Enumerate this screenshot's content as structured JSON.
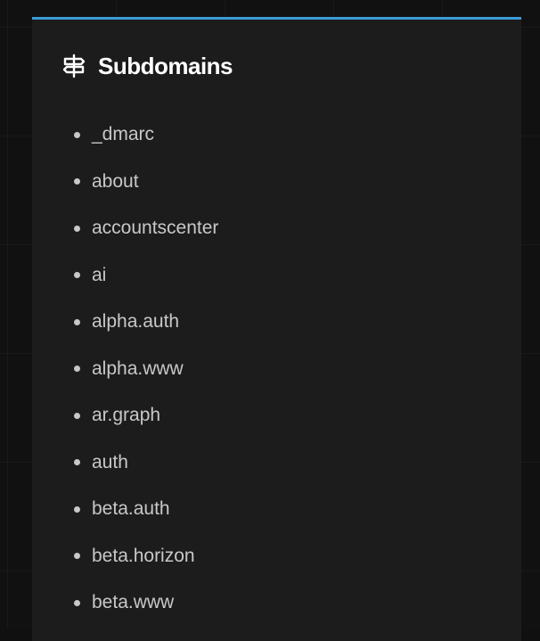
{
  "section": {
    "title": "Subdomains",
    "icon": "signpost-icon",
    "accent_color": "#3b9bd6"
  },
  "subdomains": [
    "_dmarc",
    "about",
    "accountscenter",
    "ai",
    "alpha.auth",
    "alpha.www",
    "ar.graph",
    "auth",
    "beta.auth",
    "beta.horizon",
    "beta.www"
  ]
}
